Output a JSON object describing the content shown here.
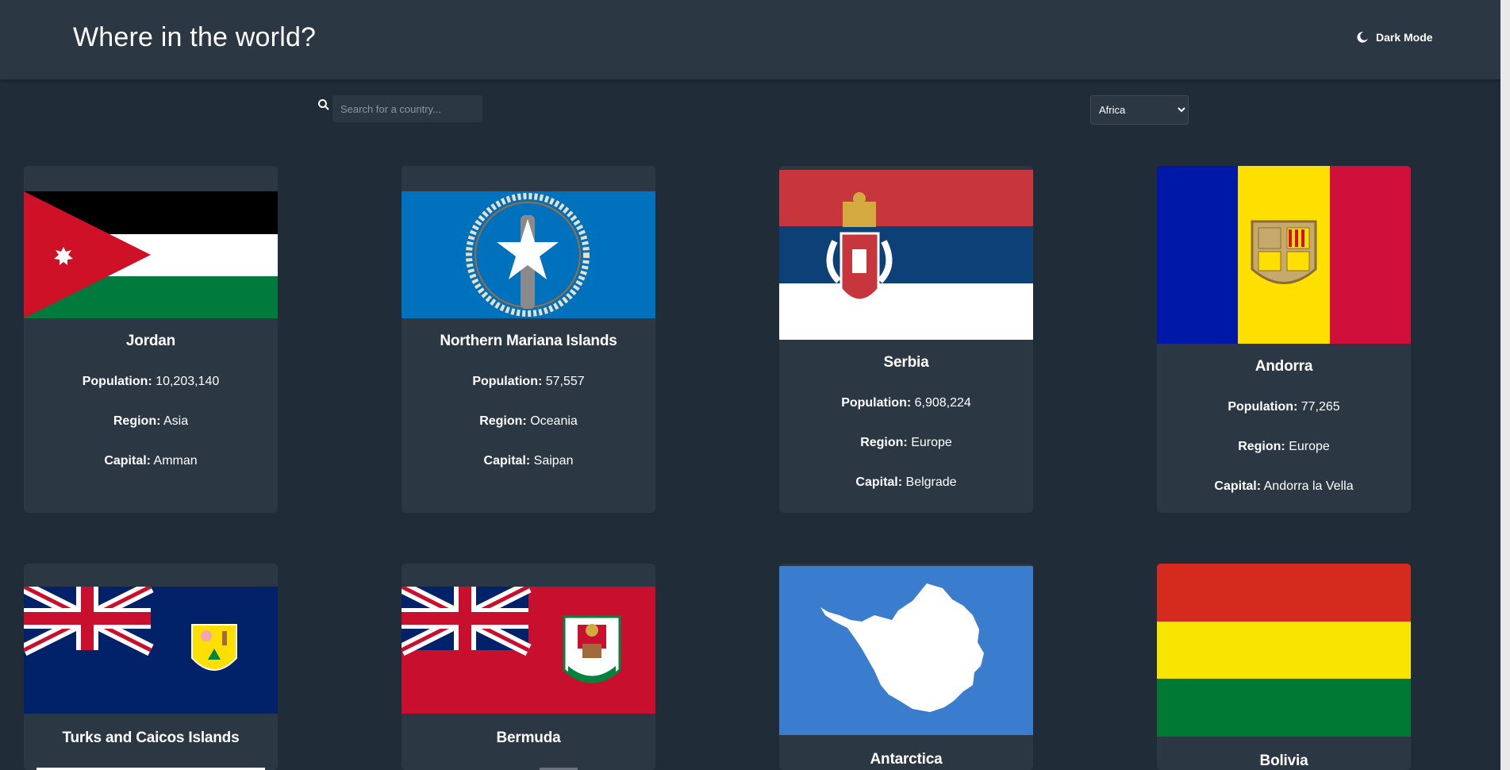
{
  "header": {
    "title": "Where in the world?",
    "theme_label": "Dark Mode"
  },
  "search": {
    "placeholder": "Search for a country..."
  },
  "filter": {
    "selected": "Africa",
    "options": [
      "Africa"
    ]
  },
  "labels": {
    "population": "Population:",
    "region": "Region:",
    "capital": "Capital:"
  },
  "countries": [
    {
      "name": "Jordan",
      "population": "10,203,140",
      "region": "Asia",
      "capital": "Amman"
    },
    {
      "name": "Northern Mariana Islands",
      "population": "57,557",
      "region": "Oceania",
      "capital": "Saipan"
    },
    {
      "name": "Serbia",
      "population": "6,908,224",
      "region": "Europe",
      "capital": "Belgrade"
    },
    {
      "name": "Andorra",
      "population": "77,265",
      "region": "Europe",
      "capital": "Andorra la Vella"
    },
    {
      "name": "Turks and Caicos Islands"
    },
    {
      "name": "Bermuda"
    },
    {
      "name": "Antarctica"
    },
    {
      "name": "Bolivia"
    }
  ],
  "colors": {
    "background": "#202c37",
    "element": "#2b3743",
    "text": "#ffffff"
  }
}
